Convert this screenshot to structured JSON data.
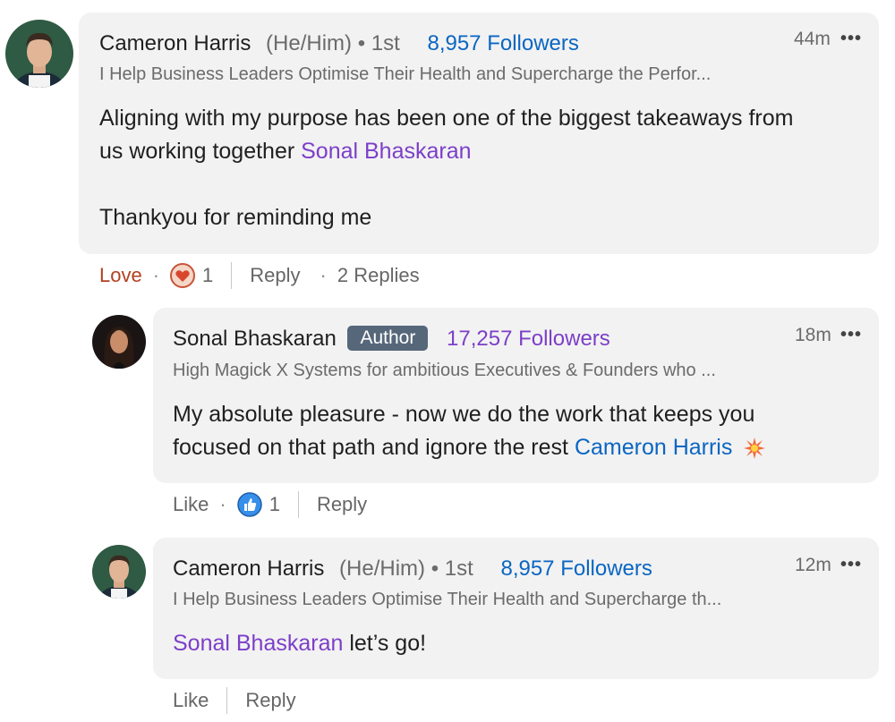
{
  "comments": [
    {
      "author": "Cameron Harris",
      "pronouns": "(He/Him) • 1st",
      "followers": "8,957 Followers",
      "time": "44m",
      "more": "•••",
      "headline": "I Help Business Leaders Optimise Their Health and Supercharge the Perfor...",
      "body_line1": "Aligning with my purpose has been one of the biggest takeaways from",
      "body_line2_prefix": "us working together ",
      "body_mention": "Sonal Bhaskaran",
      "body_line3": "Thankyou for reminding me",
      "actions": {
        "reaction_label": "Love",
        "dot": "·",
        "reaction_count": "1",
        "reply_label": "Reply",
        "replies_dot": "·",
        "replies_count": "2 Replies"
      }
    },
    {
      "author": "Sonal Bhaskaran",
      "badge": "Author",
      "followers": "17,257 Followers",
      "time": "18m",
      "more": "•••",
      "headline": "High Magick X Systems for ambitious Executives & Founders who ...",
      "body_line1": "My absolute pleasure - now we do the work that keeps you",
      "body_line2_prefix": "focused on that path and ignore the rest ",
      "body_mention": "Cameron Harris",
      "actions": {
        "reaction_label": "Like",
        "dot": "·",
        "reaction_count": "1",
        "reply_label": "Reply"
      }
    },
    {
      "author": "Cameron Harris",
      "pronouns": "(He/Him) • 1st",
      "followers": "8,957 Followers",
      "time": "12m",
      "more": "•••",
      "headline": "I Help Business Leaders Optimise Their Health and Supercharge th...",
      "body_mention": "Sonal Bhaskaran",
      "body_suffix": " let’s go!",
      "actions": {
        "reaction_label": "Like",
        "reply_label": "Reply"
      }
    }
  ],
  "icons": {
    "love": "heart-reaction-icon",
    "like": "thumbs-up-reaction-icon",
    "spark": "sparkle-emoji-icon"
  },
  "colors": {
    "bubble": "#f2f2f2",
    "followers_blue": "#0a66c2",
    "mention_purple": "#7c3fc9",
    "love_red": "#b24020",
    "badge": "#56677a"
  }
}
